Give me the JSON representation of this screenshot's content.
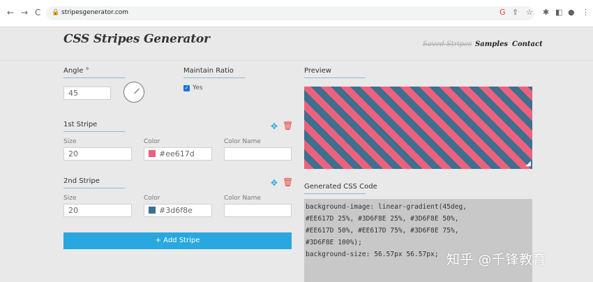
{
  "browser": {
    "back": "←",
    "forward": "→",
    "reload": "C",
    "url": "stripesgenerator.com"
  },
  "site": {
    "title": "CSS Stripes Generator",
    "nav": [
      "Saved Stripes",
      "Samples",
      "Contact"
    ]
  },
  "angle": {
    "label": "Angle °",
    "value": "45"
  },
  "ratio": {
    "label": "Maintain Ratio",
    "option": "Yes",
    "checked": true
  },
  "stripes": [
    {
      "title": "1st Stripe",
      "size_label": "Size",
      "size": "20",
      "color_label": "Color",
      "color": "#ee617d",
      "name_label": "Color Name",
      "name": ""
    },
    {
      "title": "2nd Stripe",
      "size_label": "Size",
      "size": "20",
      "color_label": "Color",
      "color": "#3d6f8e",
      "name_label": "Color Name",
      "name": ""
    }
  ],
  "add_button": "+ Add Stripe",
  "preview": {
    "label": "Preview"
  },
  "generated": {
    "label": "Generated CSS Code",
    "code": "background-image: linear-gradient(45deg,\n#EE617D 25%, #3D6F8E 25%, #3D6F8E 50%,\n#EE617D 50%, #EE617D 75%, #3D6F8E 75%,\n#3D6F8E 100%);\nbackground-size: 56.57px 56.57px;"
  },
  "watermark": "知乎 @千锋教育",
  "colors": {
    "accent": "#29a8df",
    "pink": "#EE617D",
    "blue": "#3D6F8E",
    "danger": "#e8433f"
  }
}
